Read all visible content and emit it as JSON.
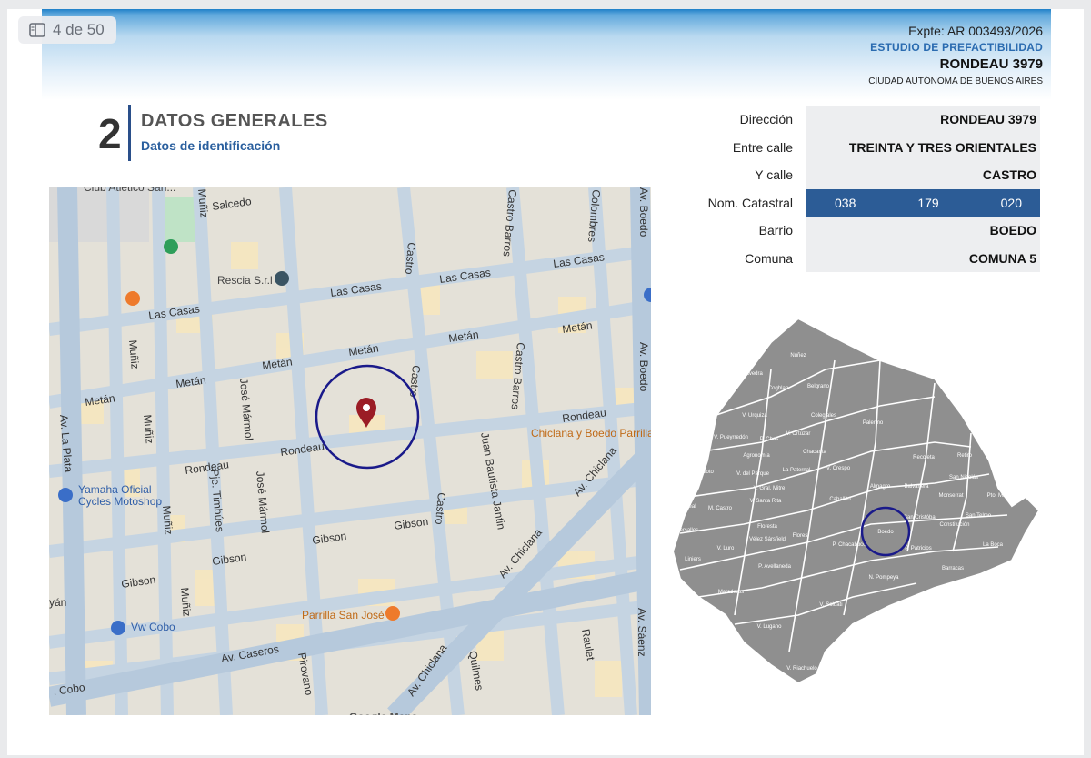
{
  "viewer": {
    "page_counter": "4 de 50",
    "icon": "sidebar-panel-icon"
  },
  "header": {
    "expediente": "Expte: AR 003493/2026",
    "estudio": "ESTUDIO DE PREFACTIBILIDAD",
    "direccion": "RONDEAU 3979",
    "ciudad": "CIUDAD AUTÓNOMA DE BUENOS AIRES"
  },
  "section": {
    "number": "2",
    "title": "DATOS GENERALES",
    "subtitle": "Datos de identificación"
  },
  "info": {
    "direccion": {
      "label": "Dirección",
      "value": "RONDEAU 3979"
    },
    "entre_calle": {
      "label": "Entre calle",
      "value": "TREINTA Y TRES ORIENTALES"
    },
    "y_calle": {
      "label": "Y calle",
      "value": "CASTRO"
    },
    "nom_catastral": {
      "label": "Nom. Catastral",
      "values": [
        "038",
        "179",
        "020"
      ]
    },
    "barrio": {
      "label": "Barrio",
      "value": "BOEDO"
    },
    "comuna": {
      "label": "Comuna",
      "value": "COMUNA 5"
    }
  },
  "street_map": {
    "streets": [
      "Salcedo",
      "Las Casas",
      "Metán",
      "Rondeau",
      "Gibson",
      "Av. Caseros",
      "Cobo",
      "Castro",
      "Castro Barros",
      "Colombres",
      "Muñiz",
      "José Mármol",
      "Pje. Timbúes",
      "Juan Bautista Jantin",
      "Av. Chiclana",
      "Av. La Plata",
      "Pirovano",
      "Quilmes",
      "Raulet",
      "Av. Boedo",
      "Av. Sáenz",
      "Yán"
    ],
    "places": [
      "Club Atlético San...",
      "Rescia S.r.l",
      "Chiclana y Boedo Parrilla",
      "Yamaha Oficial",
      "Cycles Motoshop",
      "Parrilla San José",
      "Vw Cobo",
      "Google Maps"
    ]
  },
  "barrios_map": {
    "labels": [
      "Núñez",
      "Saavedra",
      "Coghlan",
      "Belgrano",
      "V. Urquiza",
      "Colegiales",
      "Palermo",
      "V. Ortúzar",
      "V. Pueyrredón",
      "P. Chas",
      "Chacarita",
      "Agronomía",
      "Recoleta",
      "Retiro",
      "V. Devoto",
      "V. del Parque",
      "La Paternal",
      "V. Crespo",
      "San Nicolás",
      "V. Gral. Mitre",
      "Almagro",
      "Balvanera",
      "Monserrat",
      "Pto. Madero",
      "V. Real",
      "M. Castro",
      "V. Santa Rita",
      "Caballito",
      "San Cristóbal",
      "San Telmo",
      "Constitución",
      "Versalles",
      "Floresta",
      "Boedo",
      "Vélez Sársfield",
      "Flores",
      "P. Chacabuco",
      "P. Patricios",
      "La Boca",
      "V. Luro",
      "Liniers",
      "P. Avellaneda",
      "N. Pompeya",
      "Barracas",
      "Mataderos",
      "V. Soldati",
      "V. Lugano",
      "V. Riachuelo"
    ]
  }
}
